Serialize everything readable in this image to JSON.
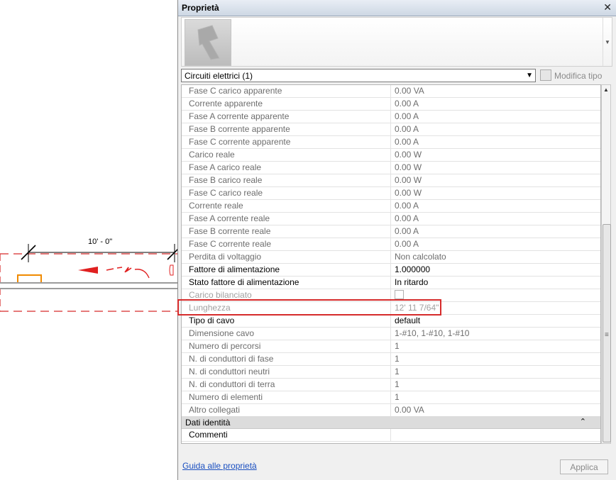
{
  "canvas": {
    "dimension_label": "10' - 0\""
  },
  "palette": {
    "title": "Proprietà",
    "close_glyph": "✕",
    "type_selector": "Circuiti elettrici (1)",
    "edit_type_label": "Modifica tipo",
    "properties": [
      {
        "name": "Fase C carico apparente",
        "value": "0.00 VA",
        "state": "ro"
      },
      {
        "name": "Corrente apparente",
        "value": "0.00 A",
        "state": "ro"
      },
      {
        "name": "Fase A corrente apparente",
        "value": "0.00 A",
        "state": "ro"
      },
      {
        "name": "Fase B corrente apparente",
        "value": "0.00 A",
        "state": "ro"
      },
      {
        "name": "Fase C corrente apparente",
        "value": "0.00 A",
        "state": "ro"
      },
      {
        "name": "Carico reale",
        "value": "0.00 W",
        "state": "ro"
      },
      {
        "name": "Fase A carico reale",
        "value": "0.00 W",
        "state": "ro"
      },
      {
        "name": "Fase B carico reale",
        "value": "0.00 W",
        "state": "ro"
      },
      {
        "name": "Fase C carico reale",
        "value": "0.00 W",
        "state": "ro"
      },
      {
        "name": "Corrente reale",
        "value": "0.00 A",
        "state": "ro"
      },
      {
        "name": "Fase A corrente reale",
        "value": "0.00 A",
        "state": "ro"
      },
      {
        "name": "Fase B corrente reale",
        "value": "0.00 A",
        "state": "ro"
      },
      {
        "name": "Fase C corrente reale",
        "value": "0.00 A",
        "state": "ro"
      },
      {
        "name": "Perdita di voltaggio",
        "value": "Non calcolato",
        "state": "ro"
      },
      {
        "name": "Fattore di alimentazione",
        "value": "1.000000",
        "state": "edit"
      },
      {
        "name": "Stato fattore di alimentazione",
        "value": "In ritardo",
        "state": "edit"
      },
      {
        "name": "Carico bilanciato",
        "value": "",
        "state": "dis",
        "checkbox": true
      },
      {
        "name": "Lunghezza",
        "value": "12'  11 7/64\"",
        "state": "dis"
      },
      {
        "name": "Tipo di cavo",
        "value": "default",
        "state": "edit"
      },
      {
        "name": "Dimensione cavo",
        "value": "1-#10, 1-#10, 1-#10",
        "state": "ro"
      },
      {
        "name": "Numero di percorsi",
        "value": "1",
        "state": "ro"
      },
      {
        "name": "N. di conduttori di fase",
        "value": "1",
        "state": "ro"
      },
      {
        "name": "N. di conduttori neutri",
        "value": "1",
        "state": "ro"
      },
      {
        "name": "N. di conduttori di terra",
        "value": "1",
        "state": "ro"
      },
      {
        "name": "Numero di elementi",
        "value": "1",
        "state": "ro"
      },
      {
        "name": "Altro collegati",
        "value": "0.00 VA",
        "state": "ro"
      }
    ],
    "group_identity": {
      "title": "Dati identità",
      "collapse_glyph": "⌃",
      "rows": [
        {
          "name": "Commenti",
          "value": ""
        }
      ]
    },
    "help_link": "Guida alle proprietà",
    "apply_label": "Applica"
  }
}
